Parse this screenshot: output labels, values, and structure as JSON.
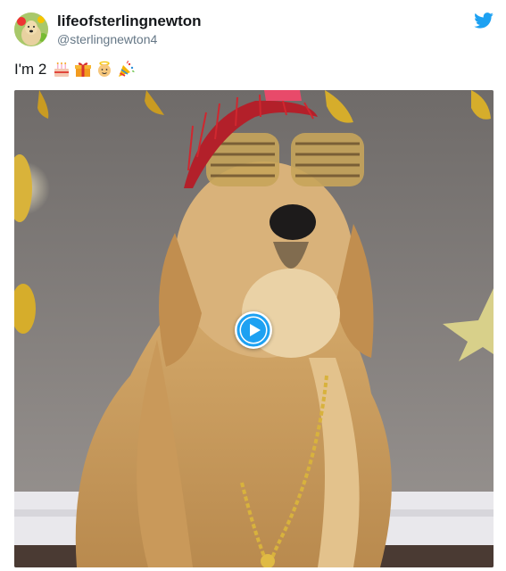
{
  "user": {
    "display_name": "lifeofsterlingnewton",
    "handle": "@sterlingnewton4"
  },
  "tweet": {
    "text": "I'm 2",
    "emojis": [
      "birthday-cake",
      "wrapped-gift",
      "baby-angel",
      "party-popper"
    ]
  },
  "icons": {
    "brand": "twitter-bird-icon",
    "media_control": "play-icon"
  },
  "colors": {
    "twitter_blue": "#1da1f2",
    "name_text": "#14171a",
    "handle_text": "#657786"
  }
}
